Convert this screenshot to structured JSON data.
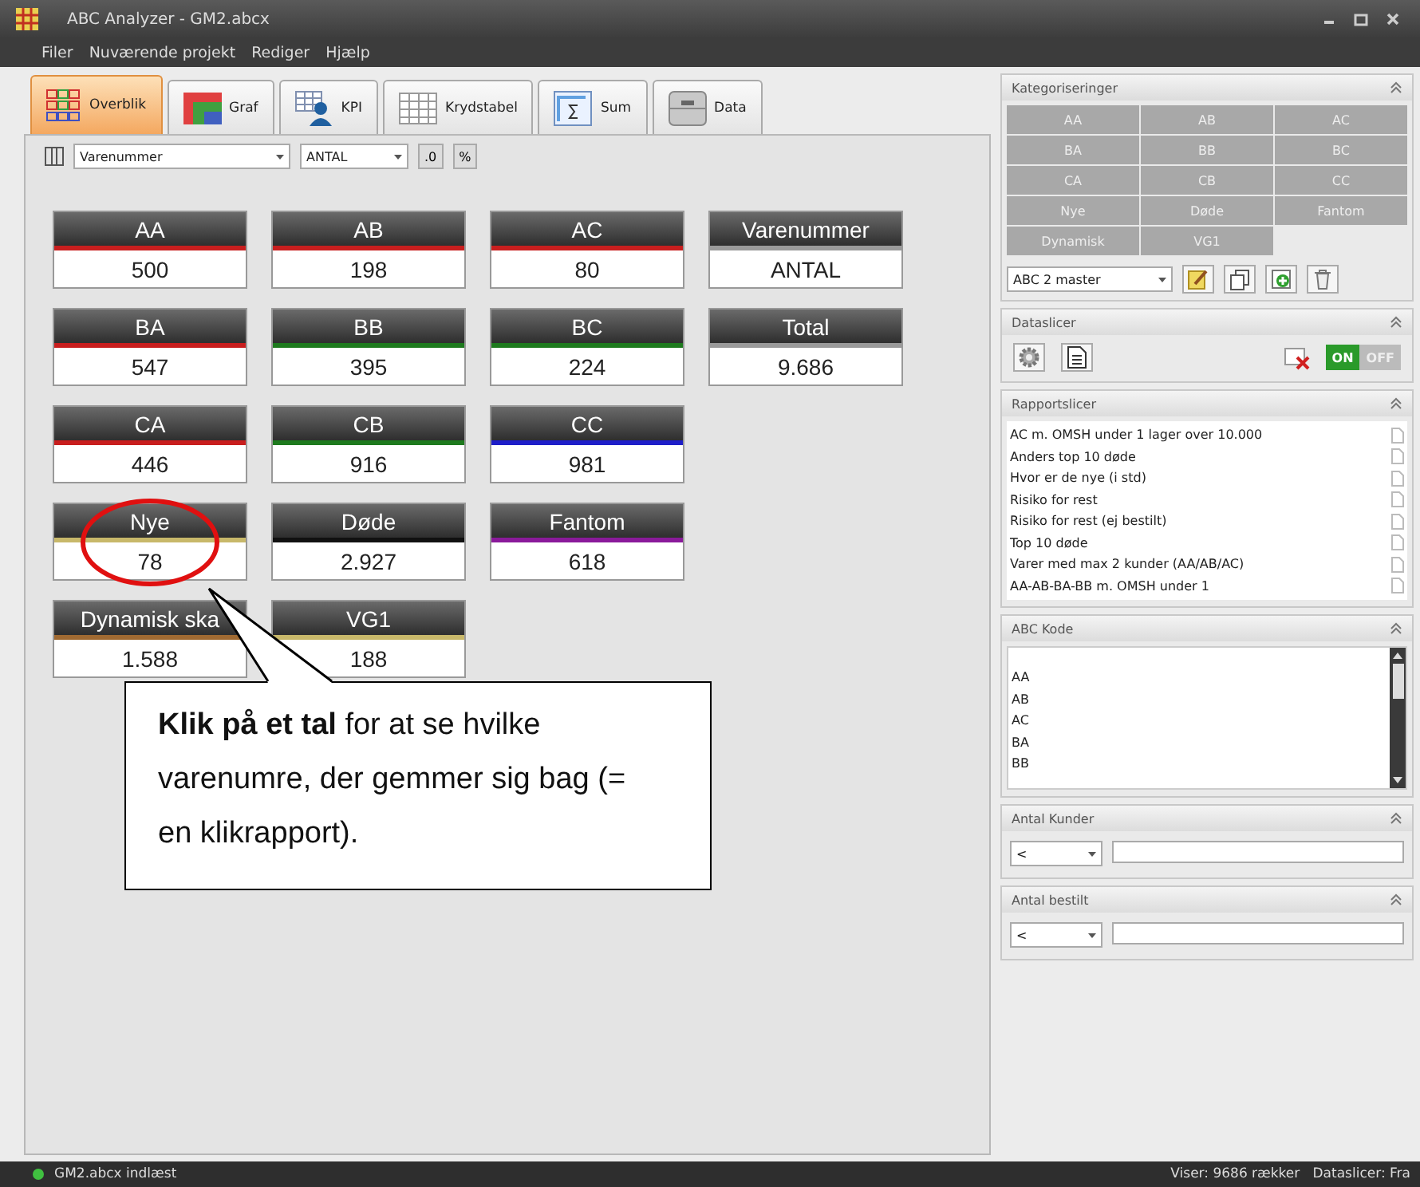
{
  "window": {
    "title": "ABC Analyzer - GM2.abcx"
  },
  "menu": [
    "Filer",
    "Nuværende projekt",
    "Rediger",
    "Hjælp"
  ],
  "tabs": [
    {
      "label": "Overblik",
      "kind": "grid",
      "selected": true
    },
    {
      "label": "Graf",
      "kind": "chart",
      "selected": false
    },
    {
      "label": "KPI",
      "kind": "person",
      "selected": false
    },
    {
      "label": "Krydstabel",
      "kind": "table",
      "selected": false
    },
    {
      "label": "Sum",
      "kind": "sum",
      "selected": false
    },
    {
      "label": "Data",
      "kind": "data",
      "selected": false
    }
  ],
  "toolbar": {
    "field": "Varenummer",
    "measure": "ANTAL",
    "buttons": [
      ".0",
      "%"
    ]
  },
  "tile_rows": [
    [
      {
        "label": "AA",
        "value": "500",
        "color": "#c81e1e"
      },
      {
        "label": "AB",
        "value": "198",
        "color": "#c81e1e"
      },
      {
        "label": "AC",
        "value": "80",
        "color": "#c81e1e"
      },
      {
        "label": "Varenummer",
        "value": "ANTAL",
        "color": "#9a9a9a"
      }
    ],
    [
      {
        "label": "BA",
        "value": "547",
        "color": "#c81e1e"
      },
      {
        "label": "BB",
        "value": "395",
        "color": "#1e7a1e"
      },
      {
        "label": "BC",
        "value": "224",
        "color": "#1e7a1e"
      },
      {
        "label": "Total",
        "value": "9.686",
        "color": "#9a9a9a"
      }
    ],
    [
      {
        "label": "CA",
        "value": "446",
        "color": "#c81e1e"
      },
      {
        "label": "CB",
        "value": "916",
        "color": "#1e7a1e"
      },
      {
        "label": "CC",
        "value": "981",
        "color": "#1e1ec8"
      }
    ],
    [
      {
        "label": "Nye",
        "value": "78",
        "color": "#c8b86a"
      },
      {
        "label": "Døde",
        "value": "2.927",
        "color": "#111111"
      },
      {
        "label": "Fantom",
        "value": "618",
        "color": "#8a1a9a"
      }
    ],
    [
      {
        "label": "Dynamisk ska",
        "value": "1.588",
        "color": "#a06a32"
      },
      {
        "label": "VG1",
        "value": "188",
        "color": "#c8b86a"
      }
    ]
  ],
  "callout": {
    "text": "**Klik på et tal** for at se hvilke varenumre, der gemmer sig bag (= en klikrapport)."
  },
  "sidebar": {
    "kategoriseringer": {
      "title": "Kategoriseringer",
      "cells": [
        "AA",
        "AB",
        "AC",
        "BA",
        "BB",
        "BC",
        "CA",
        "CB",
        "CC",
        "Nye",
        "Døde",
        "Fantom",
        "Dynamisk",
        "VG1"
      ],
      "select": "ABC 2 master"
    },
    "dataslicer": {
      "title": "Dataslicer",
      "toggle_on": "ON",
      "toggle_off": "OFF",
      "on": true
    },
    "rapportslicer": {
      "title": "Rapportslicer",
      "items": [
        "AC m. OMSH under 1 lager over 10.000",
        "Anders top 10 døde",
        "Hvor er de nye (i std)",
        "Risiko for rest",
        "Risiko for rest (ej bestilt)",
        "Top 10 døde",
        "Varer med max 2 kunder (AA/AB/AC)",
        "AA-AB-BA-BB m. OMSH under 1"
      ]
    },
    "abc_kode": {
      "title": "ABC Kode",
      "items": [
        "AA",
        "AB",
        "AC",
        "BA",
        "BB"
      ]
    },
    "filters": [
      {
        "title": "Antal Kunder",
        "operator": "<"
      },
      {
        "title": "Antal bestilt",
        "operator": "<"
      }
    ]
  },
  "status_bar": {
    "left": "GM2.abcx indlæst",
    "right": "Viser: 9686 rækker   Dataslicer: Fra"
  }
}
